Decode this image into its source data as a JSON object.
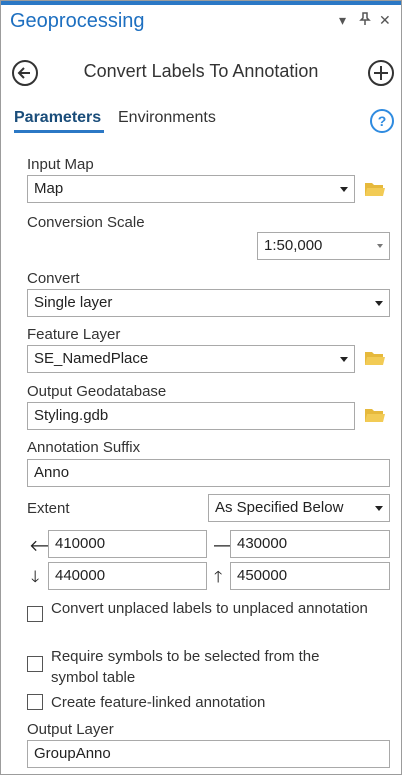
{
  "header": {
    "title": "Geoprocessing",
    "menu_glyph": "▾",
    "pin_glyph": "⊥",
    "close_glyph": "✕"
  },
  "tool": {
    "title": "Convert Labels To Annotation"
  },
  "tabs": {
    "parameters": "Parameters",
    "environments": "Environments",
    "help_glyph": "?"
  },
  "form": {
    "input_map": {
      "label": "Input Map",
      "value": "Map"
    },
    "conversion_scale": {
      "label": "Conversion Scale",
      "value": "1:50,000"
    },
    "convert": {
      "label": "Convert",
      "value": "Single layer"
    },
    "feature_layer": {
      "label": "Feature Layer",
      "value": "SE_NamedPlace"
    },
    "output_geodatabase": {
      "label": "Output Geodatabase",
      "value": "Styling.gdb"
    },
    "annotation_suffix": {
      "label": "Annotation Suffix",
      "value": "Anno"
    },
    "extent": {
      "label": "Extent",
      "mode": "As Specified Below",
      "left": "410000",
      "right": "430000",
      "bottom": "440000",
      "top": "450000"
    },
    "checkboxes": {
      "unplaced": {
        "label": "Convert unplaced labels to unplaced annotation",
        "checked": false
      },
      "require_symbols": {
        "label": "Require symbols to be selected from the symbol table",
        "checked": false
      },
      "feature_linked": {
        "label": "Create feature-linked annotation",
        "checked": false
      }
    },
    "output_layer": {
      "label": "Output Layer",
      "value": "GroupAnno"
    }
  },
  "colors": {
    "accent": "#2b78c5",
    "title": "#1d6fc0",
    "folder": "#e6b93c"
  },
  "icons": [
    "back-icon",
    "add-icon",
    "help-icon",
    "folder-icon",
    "left-arrow-icon",
    "right-arrow-icon",
    "down-arrow-icon",
    "up-arrow-icon",
    "chevron-down-icon",
    "pin-icon",
    "close-icon"
  ]
}
